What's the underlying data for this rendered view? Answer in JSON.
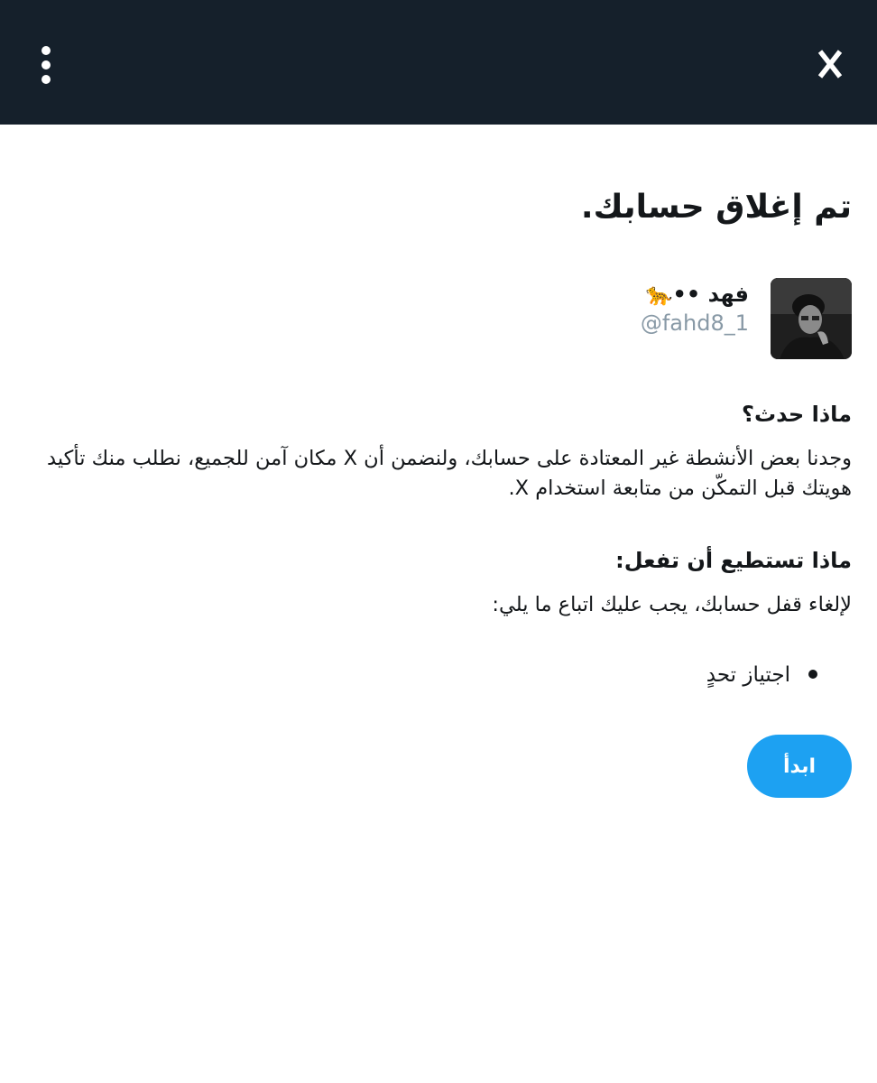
{
  "header": {
    "close_label": "X",
    "menu_icon": "more-vertical-icon",
    "background": "#15202b"
  },
  "main": {
    "title": "تم إغلاق حسابك.",
    "user": {
      "name": "فهد ••🐆",
      "handle": "@fahd8_1"
    },
    "what_happened": {
      "heading": "ماذا حدث؟",
      "body": "وجدنا بعض الأنشطة غير المعتادة على حسابك، ولنضمن أن X مكان آمن للجميع، نطلب منك تأكيد هويتك قبل التمكّن من متابعة استخدام X."
    },
    "what_to_do": {
      "heading": "ماذا تستطيع أن تفعل:",
      "body": "لإلغاء قفل حسابك، يجب عليك اتباع ما يلي:",
      "steps": [
        "اجتياز تحدٍ"
      ]
    },
    "start_button": "ابدأ",
    "accent_color": "#1da1f2"
  }
}
